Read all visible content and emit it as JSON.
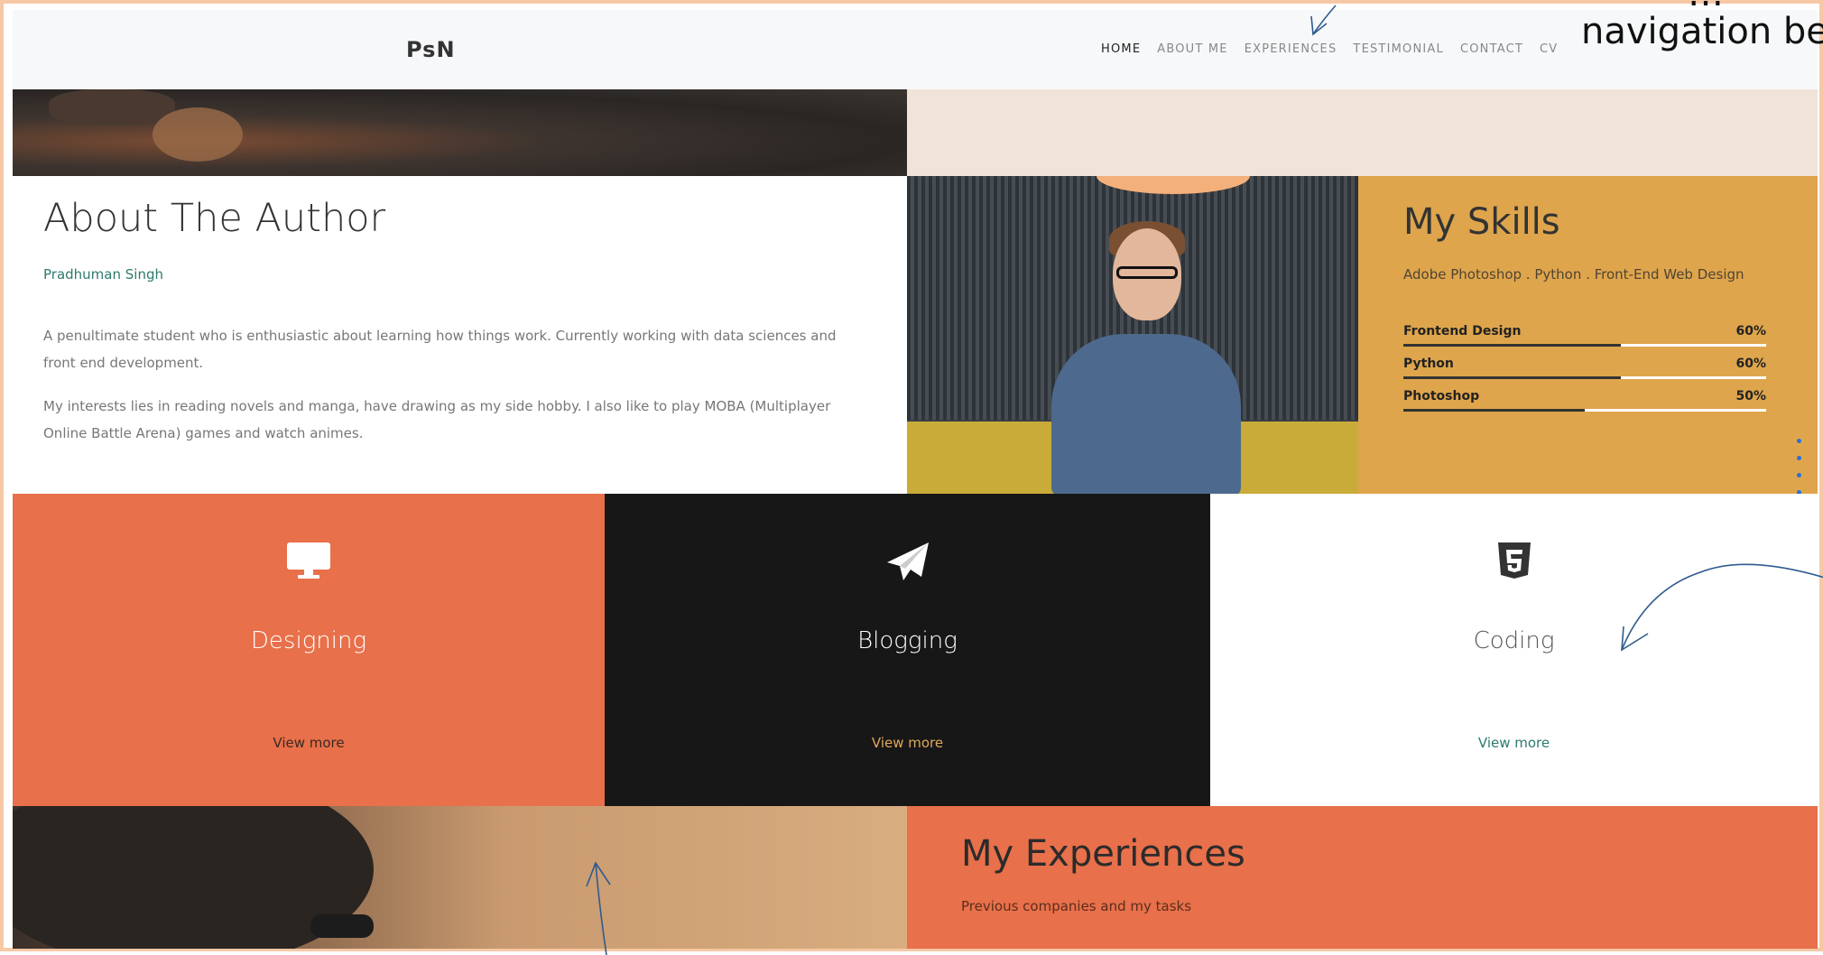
{
  "header": {
    "logo": "PsN",
    "nav": [
      "HOME",
      "ABOUT ME",
      "EXPERIENCES",
      "TESTIMONIAL",
      "CONTACT",
      "CV"
    ]
  },
  "about": {
    "title": "About The Author",
    "name": "Pradhuman Singh",
    "p1": "A penultimate student who is enthusiastic about learning how things work. Currently working with data sciences and front end development.",
    "p2": "My interests lies in reading novels and manga, have drawing as my side hobby. I also like to play MOBA (Multiplayer Online Battle Arena) games and watch animes."
  },
  "skills": {
    "title": "My Skills",
    "subtitle": "Adobe Photoshop . Python . Front-End Web Design",
    "items": [
      {
        "name": "Frontend Design",
        "percent": "60%",
        "value": 0.6
      },
      {
        "name": "Python",
        "percent": "60%",
        "value": 0.6
      },
      {
        "name": "Photoshop",
        "percent": "50%",
        "value": 0.5
      }
    ]
  },
  "services": [
    {
      "title": "Designing",
      "more": "View more",
      "icon": "monitor-icon"
    },
    {
      "title": "Blogging",
      "more": "View more",
      "icon": "paper-plane-icon"
    },
    {
      "title": "Coding",
      "more": "View more",
      "icon": "html5-icon"
    }
  ],
  "experiences": {
    "title": "My Experiences",
    "subtitle": "Previous companies and my tasks"
  },
  "annotation": {
    "line1": "…",
    "line2": "navigation be"
  },
  "colors": {
    "orange": "#e8704a",
    "gold": "#dfa54c",
    "dark": "#171717",
    "teal": "#2c7a6e",
    "arrow": "#2e5b8e"
  }
}
